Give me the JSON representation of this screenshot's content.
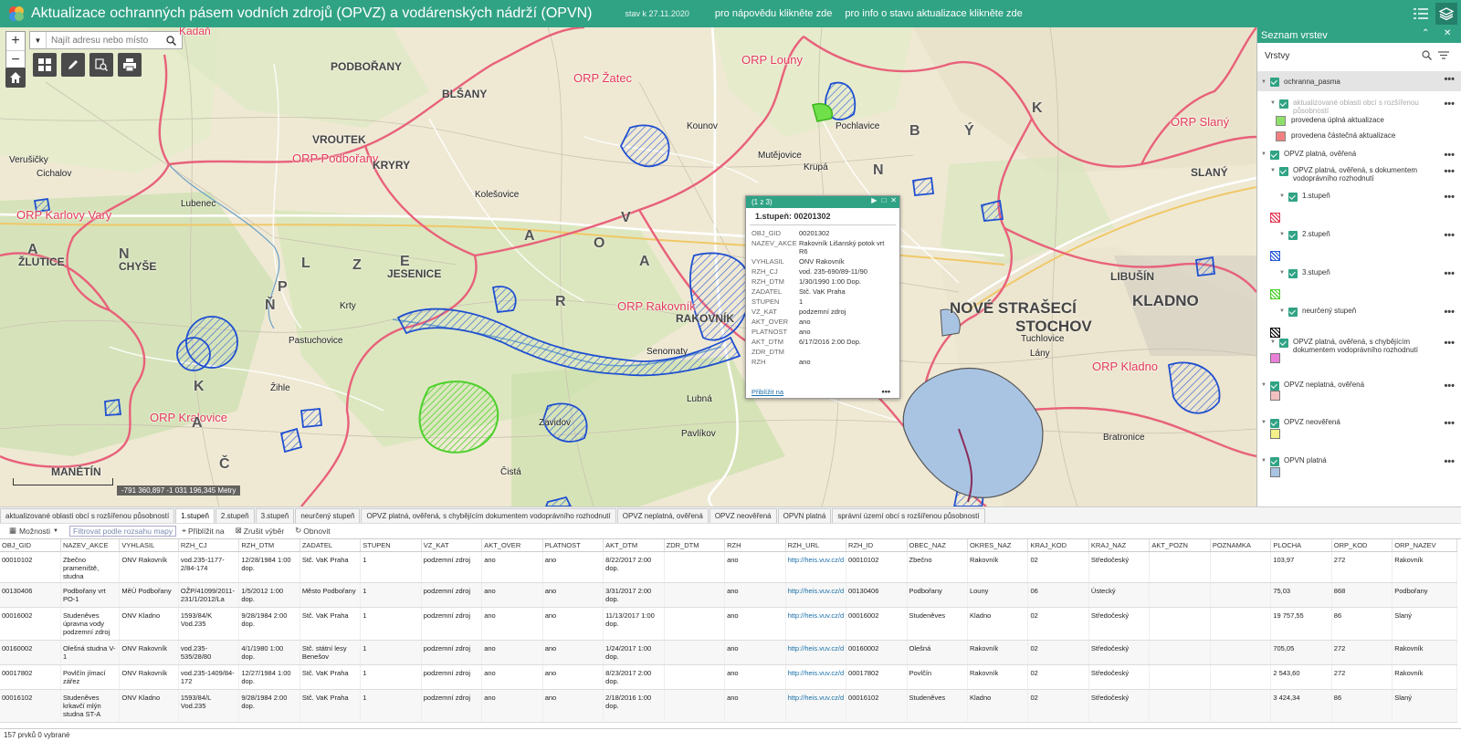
{
  "header": {
    "title": "Aktualizace ochranných pásem vodních zdrojů (OPVZ) a vodárenských nádrží (OPVN)",
    "stav": "stav k 27.11.2020",
    "link_help": "pro nápovědu klikněte zde",
    "link_info": "pro info o stavu aktualizace klikněte zde",
    "accent": "#31a385"
  },
  "map": {
    "search_placeholder": "Najít adresu nebo místo",
    "coordinates": "-791 360,897 -1 031 196,345 Metry",
    "labels_orp": [
      "Kadaň",
      "ORP Louny",
      "ORP Žatec",
      "ORP Podbořany",
      "ORP Slaný",
      "ORP Karlovy Vary",
      "ORP Rakovník",
      "ORP Kladno",
      "ORP Kralovice"
    ],
    "labels_towns": [
      "PODBOŘANY",
      "BLŠANY",
      "VROUTEK",
      "KRYRY",
      "Lubenec",
      "Verušičky",
      "Cichalov",
      "ŽLUTICE",
      "CHYŠE",
      "JESENICE",
      "Kolešovice",
      "Pochlavice",
      "Kounov",
      "Mutějovice",
      "Krupá",
      "NOVÉ STRAŠECÍ",
      "STOCHOV",
      "KLADNO",
      "SLANÝ",
      "Lány",
      "RAKOVNÍK",
      "Senomaty",
      "Krty",
      "Pastuchovice",
      "Žihle",
      "MANĚTÍN",
      "Čistá",
      "Zavidov",
      "Lubná",
      "Pavlíkov",
      "Tuchlovice",
      "LIBUŠÍN",
      "Bratronice"
    ],
    "labels_region": [
      "P",
      "L",
      "Z",
      "E",
      "Ň",
      "K",
      "A",
      "Č",
      "A",
      "R",
      "O",
      "V",
      "A",
      "N",
      "A",
      "N",
      "B",
      "Ý",
      "K"
    ]
  },
  "popup": {
    "counter": "(1 z 3)",
    "title": "1.stupeň: 00201302",
    "fields": [
      {
        "k": "OBJ_GID",
        "v": "00201302"
      },
      {
        "k": "NAZEV_AKCE",
        "v": "Rakovník Lišanský potok vrt R6"
      },
      {
        "k": "VYHLASIL",
        "v": "ONV Rakovník"
      },
      {
        "k": "RZH_CJ",
        "v": "vod. 235-690/89-11/90"
      },
      {
        "k": "RZH_DTM",
        "v": "1/30/1990 1:00 Dop."
      },
      {
        "k": "ZADATEL",
        "v": "Stč. VaK Praha"
      },
      {
        "k": "STUPEN",
        "v": "1"
      },
      {
        "k": "VZ_KAT",
        "v": "podzemní zdroj"
      },
      {
        "k": "AKT_OVER",
        "v": "ano"
      },
      {
        "k": "PLATNOST",
        "v": "ano"
      },
      {
        "k": "AKT_DTM",
        "v": "6/17/2016 2:00 Dop."
      },
      {
        "k": "ZDR_DTM",
        "v": ""
      },
      {
        "k": "RZH",
        "v": "ano"
      }
    ],
    "zoom_link": "Přiblížit na",
    "more": "•••"
  },
  "layers": {
    "title": "Seznam vrstev",
    "section": "Vrstvy",
    "items": [
      {
        "label": "ochranna_pasma"
      },
      {
        "label": "aktualizované oblasti obcí s rozšířenou působností"
      },
      {
        "label": "provedena úplná aktualizace",
        "color": "#8fe06a"
      },
      {
        "label": "provedena částečná aktualizace",
        "color": "#f08080"
      },
      {
        "label": "OPVZ platná, ověřená"
      },
      {
        "label": "OPVZ platná, ověřená, s dokumentem vodoprávního rozhodnutí"
      },
      {
        "label": "1.stupeň"
      },
      {
        "label": "2.stupeň"
      },
      {
        "label": "3.stupeň"
      },
      {
        "label": "neurčený stupeň"
      },
      {
        "label": "OPVZ platná, ověřená, s chybějícím dokumentem vodoprávního rozhodnutí",
        "color": "#e87fd8"
      },
      {
        "label": "OPVZ neplatná, ověřená",
        "color": "#f2c0c0"
      },
      {
        "label": "OPVZ neověřená",
        "color": "#f3f08a"
      },
      {
        "label": "OPVN platná",
        "color": "#a9c4e3"
      }
    ]
  },
  "tabs": [
    "aktualizované oblasti obcí s rozšířenou působností",
    "1.stupeň",
    "2.stupeň",
    "3.stupeň",
    "neurčený stupeň",
    "OPVZ platná, ověřená, s chybějícím dokumentem vodoprávního rozhodnutí",
    "OPVZ neplatná, ověřená",
    "OPVZ neověřená",
    "OPVN platná",
    "správní území obcí s rozšířenou působností"
  ],
  "active_tab": 1,
  "toolbar": {
    "options": "Možnosti",
    "filter": "Filtrovat podle rozsahu mapy",
    "zoom": "Přiblížit na",
    "clear": "Zrušit výběr",
    "refresh": "Obnovit"
  },
  "table": {
    "columns": [
      "OBJ_GID",
      "NAZEV_AKCE",
      "VYHLASIL",
      "RZH_CJ",
      "RZH_DTM",
      "ZADATEL",
      "STUPEN",
      "VZ_KAT",
      "AKT_OVER",
      "PLATNOST",
      "AKT_DTM",
      "ZDR_DTM",
      "RZH",
      "RZH_URL",
      "RZH_ID",
      "OBEC_NAZ",
      "OKRES_NAZ",
      "KRAJ_KOD",
      "KRAJ_NAZ",
      "AKT_POZN",
      "POZNAMKA",
      "PLOCHA",
      "ORP_KOD",
      "ORP_NAZEV"
    ],
    "rows": [
      [
        "00010102",
        "Zbečno prameniště, studna",
        "ONV Rakovník",
        "vod.235-1177-2/84-174",
        "12/28/1984 1:00 dop.",
        "Stč. VaK Praha",
        "1",
        "podzemní zdroj",
        "ano",
        "ano",
        "8/22/2017 2:00 dop.",
        "",
        "ano",
        "http://heis.vuv.cz/d",
        "00010102",
        "Zbečno",
        "Rakovník",
        "02",
        "Středočeský",
        "",
        "",
        "103,97",
        "272",
        "Rakovník"
      ],
      [
        "00130406",
        "Podbořany vrt PO-1",
        "MěÚ Podbořany",
        "OŽP/41099/2011-231/1/2012/La",
        "1/5/2012 1:00 dop.",
        "Město Podbořany",
        "1",
        "podzemní zdroj",
        "ano",
        "ano",
        "3/31/2017 2:00 dop.",
        "",
        "ano",
        "http://heis.vuv.cz/d",
        "00130406",
        "Podbořany",
        "Louny",
        "06",
        "Ústecký",
        "",
        "",
        "75,03",
        "868",
        "Podbořany"
      ],
      [
        "00016002",
        "Studeněves úpravna vody podzemní zdroj",
        "ONV Kladno",
        "1593/84/K Vod.235",
        "9/28/1984 2:00 dop.",
        "Stč. VaK Praha",
        "1",
        "podzemní zdroj",
        "ano",
        "ano",
        "11/13/2017 1:00 dop.",
        "",
        "ano",
        "http://heis.vuv.cz/d",
        "00016002",
        "Studeněves",
        "Kladno",
        "02",
        "Středočeský",
        "",
        "",
        "19 757,55",
        "86",
        "Slaný"
      ],
      [
        "00160002",
        "Olešná studna V-1",
        "ONV Rakovník",
        "vod.235-535/28/80",
        "4/1/1980 1:00 dop.",
        "Stč. státní lesy Benešov",
        "1",
        "podzemní zdroj",
        "ano",
        "ano",
        "1/24/2017 1:00 dop.",
        "",
        "ano",
        "http://heis.vuv.cz/d",
        "00160002",
        "Olešná",
        "Rakovník",
        "02",
        "Středočeský",
        "",
        "",
        "705,05",
        "272",
        "Rakovník"
      ],
      [
        "00017802",
        "Povlčín jímací zářez",
        "ONV Rakovník",
        "vod.235-1409/84-172",
        "12/27/1984 1:00 dop.",
        "Stč. VaK Praha",
        "1",
        "podzemní zdroj",
        "ano",
        "ano",
        "8/23/2017 2:00 dop.",
        "",
        "ano",
        "http://heis.vuv.cz/d",
        "00017802",
        "Povlčín",
        "Rakovník",
        "02",
        "Středočeský",
        "",
        "",
        "2 543,60",
        "272",
        "Rakovník"
      ],
      [
        "00016102",
        "Studeněves krkavčí mlýn studna ST-A",
        "ONV Kladno",
        "1593/84/L Vod.235",
        "9/28/1984 2:00 dop.",
        "Stč. VaK Praha",
        "1",
        "podzemní zdroj",
        "ano",
        "ano",
        "2/18/2016 1:00 dop.",
        "",
        "ano",
        "http://heis.vuv.cz/d",
        "00016102",
        "Studeněves",
        "Kladno",
        "02",
        "Středočeský",
        "",
        "",
        "3 424,34",
        "86",
        "Slaný"
      ]
    ]
  },
  "footer": "157 prvků 0 vybrané"
}
